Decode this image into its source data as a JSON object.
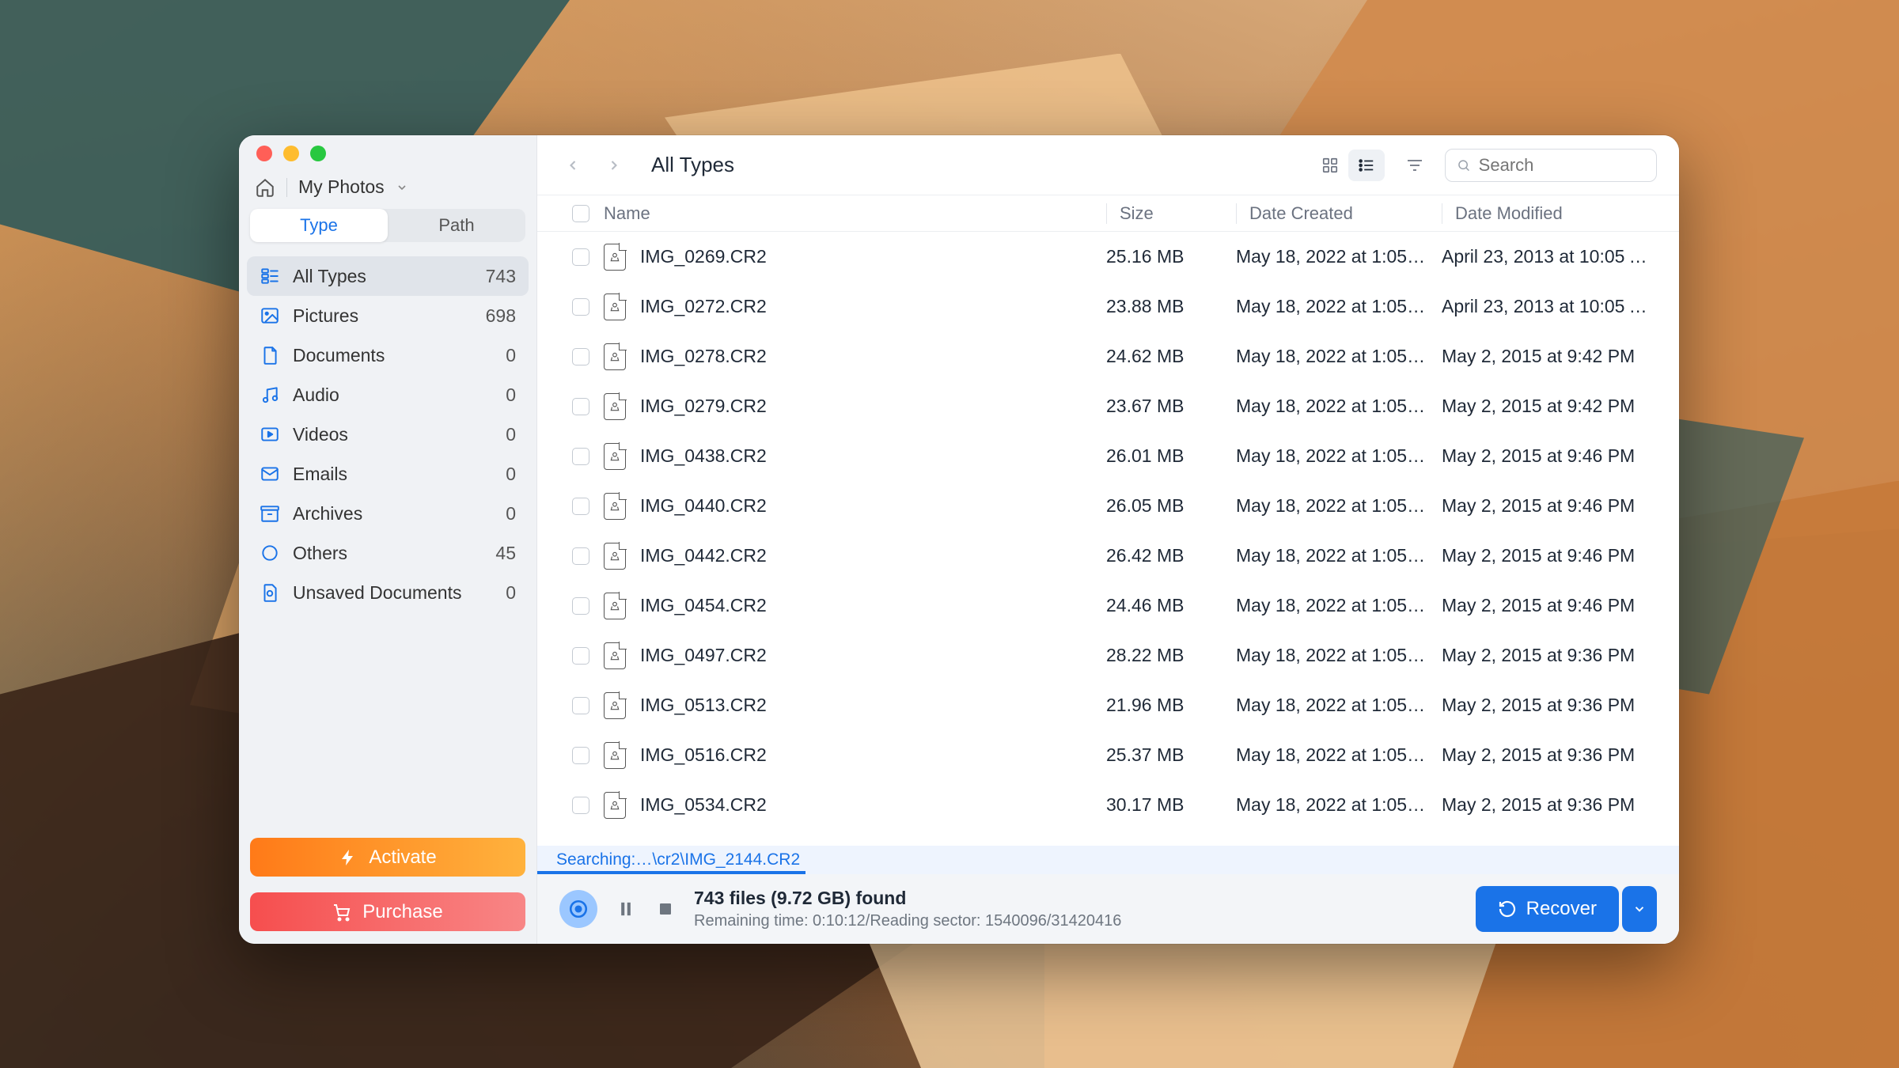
{
  "breadcrumb": {
    "location": "My Photos"
  },
  "tabs": {
    "type": "Type",
    "path": "Path"
  },
  "categories": [
    {
      "key": "all",
      "label": "All Types",
      "count": "743",
      "icon": "grid",
      "active": true
    },
    {
      "key": "pictures",
      "label": "Pictures",
      "count": "698",
      "icon": "image",
      "active": false
    },
    {
      "key": "documents",
      "label": "Documents",
      "count": "0",
      "icon": "doc",
      "active": false
    },
    {
      "key": "audio",
      "label": "Audio",
      "count": "0",
      "icon": "music",
      "active": false
    },
    {
      "key": "videos",
      "label": "Videos",
      "count": "0",
      "icon": "video",
      "active": false
    },
    {
      "key": "emails",
      "label": "Emails",
      "count": "0",
      "icon": "mail",
      "active": false
    },
    {
      "key": "archives",
      "label": "Archives",
      "count": "0",
      "icon": "archive",
      "active": false
    },
    {
      "key": "others",
      "label": "Others",
      "count": "45",
      "icon": "circle",
      "active": false
    },
    {
      "key": "unsaved",
      "label": "Unsaved Documents",
      "count": "0",
      "icon": "unsaved",
      "active": false
    }
  ],
  "cta": {
    "activate": "Activate",
    "purchase": "Purchase"
  },
  "toolbar": {
    "title": "All Types"
  },
  "search": {
    "placeholder": "Search"
  },
  "columns": {
    "name": "Name",
    "size": "Size",
    "created": "Date Created",
    "modified": "Date Modified"
  },
  "files": [
    {
      "name": "IMG_0269.CR2",
      "size": "25.16 MB",
      "created": "May 18, 2022 at 1:05…",
      "modified": "April 23, 2013 at 10:05 A…"
    },
    {
      "name": "IMG_0272.CR2",
      "size": "23.88 MB",
      "created": "May 18, 2022 at 1:05…",
      "modified": "April 23, 2013 at 10:05 A…"
    },
    {
      "name": "IMG_0278.CR2",
      "size": "24.62 MB",
      "created": "May 18, 2022 at 1:05…",
      "modified": "May 2, 2015 at 9:42 PM"
    },
    {
      "name": "IMG_0279.CR2",
      "size": "23.67 MB",
      "created": "May 18, 2022 at 1:05…",
      "modified": "May 2, 2015 at 9:42 PM"
    },
    {
      "name": "IMG_0438.CR2",
      "size": "26.01 MB",
      "created": "May 18, 2022 at 1:05…",
      "modified": "May 2, 2015 at 9:46 PM"
    },
    {
      "name": "IMG_0440.CR2",
      "size": "26.05 MB",
      "created": "May 18, 2022 at 1:05…",
      "modified": "May 2, 2015 at 9:46 PM"
    },
    {
      "name": "IMG_0442.CR2",
      "size": "26.42 MB",
      "created": "May 18, 2022 at 1:05…",
      "modified": "May 2, 2015 at 9:46 PM"
    },
    {
      "name": "IMG_0454.CR2",
      "size": "24.46 MB",
      "created": "May 18, 2022 at 1:05…",
      "modified": "May 2, 2015 at 9:46 PM"
    },
    {
      "name": "IMG_0497.CR2",
      "size": "28.22 MB",
      "created": "May 18, 2022 at 1:05…",
      "modified": "May 2, 2015 at 9:36 PM"
    },
    {
      "name": "IMG_0513.CR2",
      "size": "21.96 MB",
      "created": "May 18, 2022 at 1:05…",
      "modified": "May 2, 2015 at 9:36 PM"
    },
    {
      "name": "IMG_0516.CR2",
      "size": "25.37 MB",
      "created": "May 18, 2022 at 1:05…",
      "modified": "May 2, 2015 at 9:36 PM"
    },
    {
      "name": "IMG_0534.CR2",
      "size": "30.17 MB",
      "created": "May 18, 2022 at 1:05…",
      "modified": "May 2, 2015 at 9:36 PM"
    }
  ],
  "status": {
    "searching": "Searching:…\\cr2\\IMG_2144.CR2"
  },
  "footer": {
    "summary": "743 files (9.72 GB) found",
    "detail": "Remaining time: 0:10:12/Reading sector: 1540096/31420416",
    "recover": "Recover"
  },
  "colors": {
    "accent": "#1a73e8",
    "orange": "#ff8a1f",
    "red": "#f65d5d"
  }
}
